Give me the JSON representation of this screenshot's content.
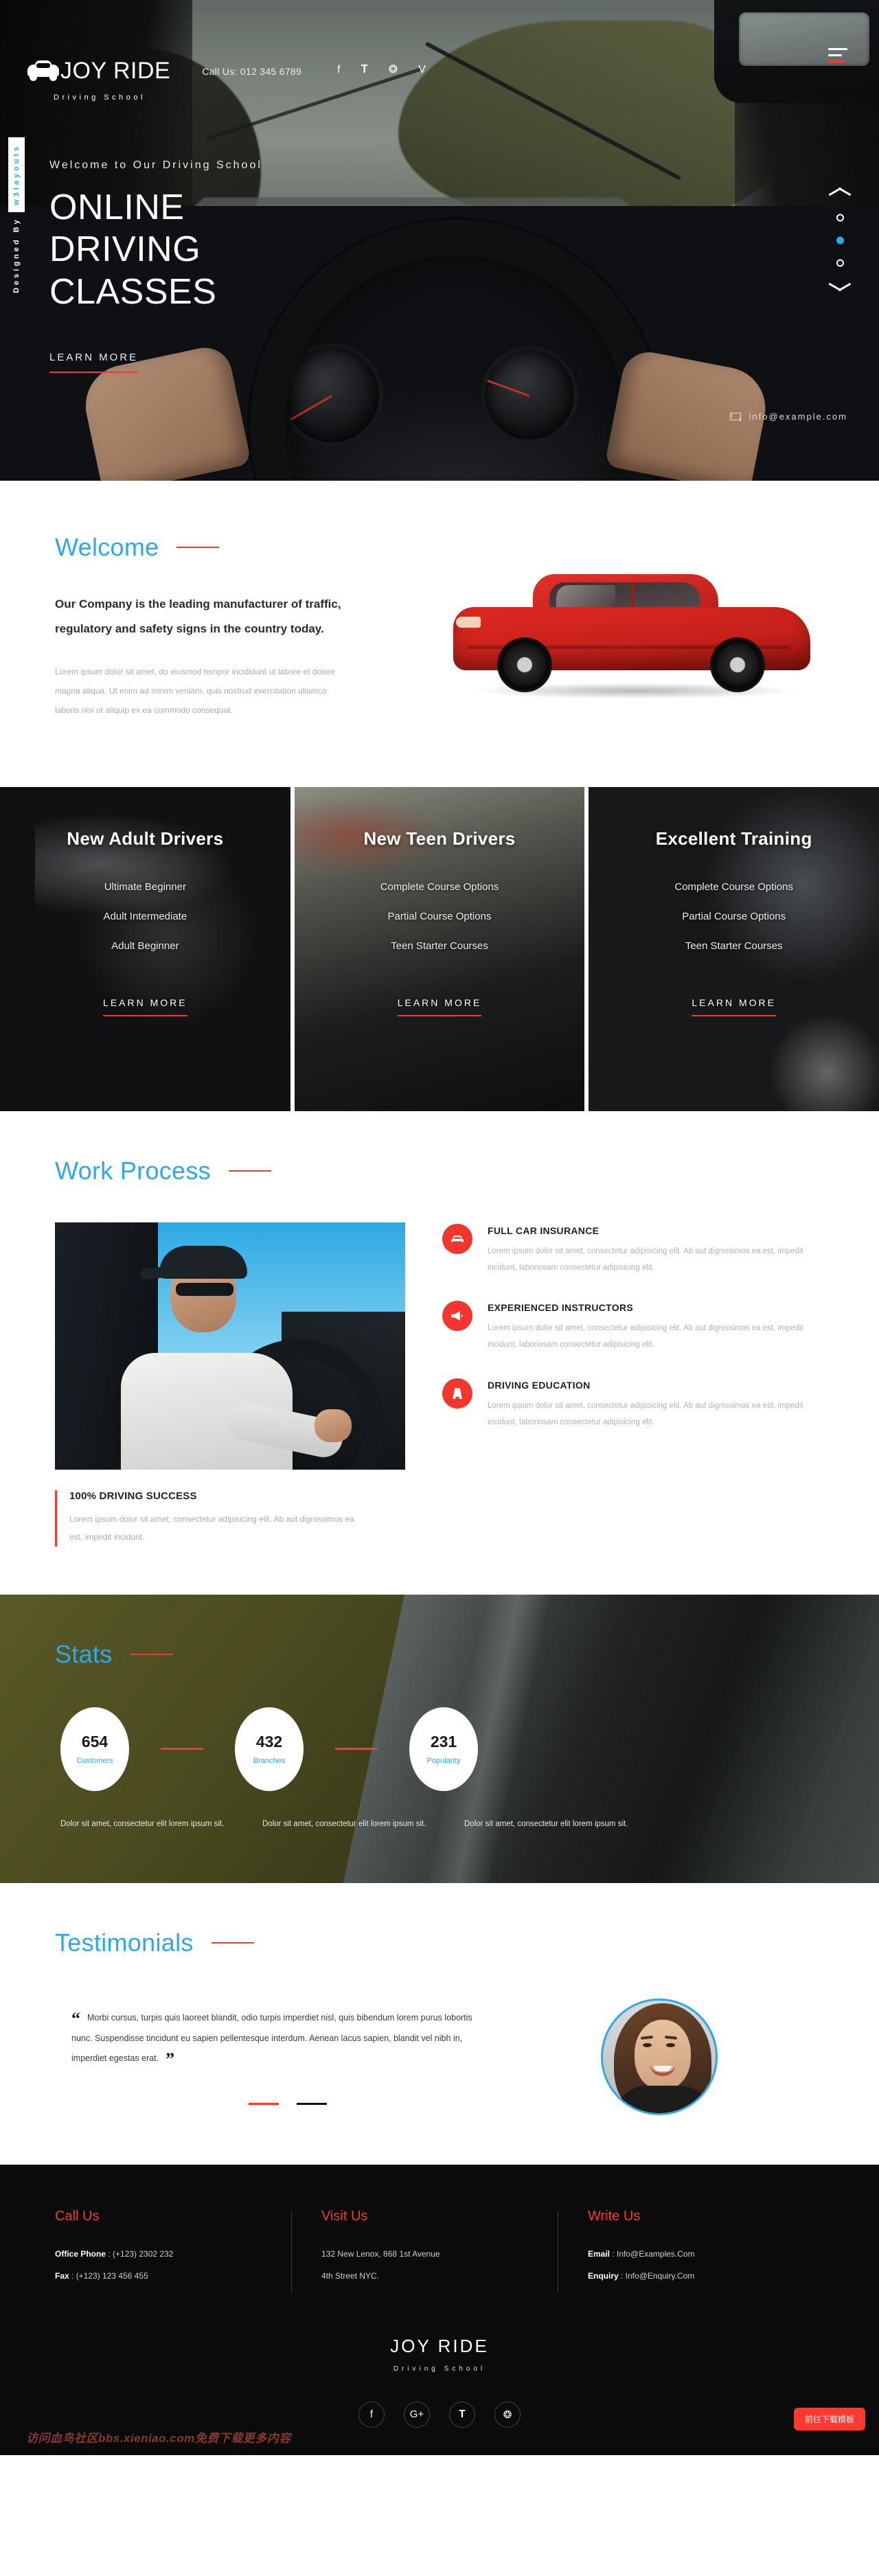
{
  "header": {
    "brand_name": "JOY RIDE",
    "brand_sub": "Driving School",
    "call_us": "Call Us: 012 345 6789",
    "social": [
      "f",
      "𝐓",
      "❂",
      "V"
    ],
    "social_names": [
      "facebook",
      "twitter",
      "dribbble",
      "vimeo"
    ]
  },
  "hero": {
    "designed_by": "Designed By",
    "designed_brand": "w3layouts",
    "kicker": "Welcome to Our Driving School",
    "title": "ONLINE DRIVING CLASSES",
    "cta": "LEARN MORE",
    "email": "info@example.com",
    "slide_count": 3,
    "active_slide": 2
  },
  "welcome": {
    "title": "Welcome",
    "heading": "Our Company is the leading manufacturer of traffic, regulatory and safety signs in the country today.",
    "paragraph": "Lorem ipsum dolor sit amet, do eiusmod tempor incididunt ut labore et dolore magna aliqua. Ut enim ad minim veniam, quis nostrud exercitation ullamco laboris nisi ut aliquip ex ea commodo consequat."
  },
  "courses": [
    {
      "title": "New Adult Drivers",
      "items": [
        "Ultimate Beginner",
        "Adult Intermediate",
        "Adult Beginner"
      ],
      "cta": "LEARN MORE"
    },
    {
      "title": "New Teen Drivers",
      "items": [
        "Complete Course Options",
        "Partial Course Options",
        "Teen Starter Courses"
      ],
      "cta": "LEARN MORE"
    },
    {
      "title": "Excellent Training",
      "items": [
        "Complete Course Options",
        "Partial Course Options",
        "Teen Starter Courses"
      ],
      "cta": "LEARN MORE"
    }
  ],
  "work": {
    "title": "Work Process",
    "success_heading": "100% DRIVING SUCCESS",
    "success_text": "Lorem ipsum dolor sit amet, consectetur adipisicing elit. Ab aut dignissimos ea est, impedit incidunt.",
    "features": [
      {
        "icon": "car-icon",
        "heading": "FULL CAR INSURANCE",
        "text": "Lorem ipsum dolor sit amet, consectetur adipisicing elit. Ab aut dignissimos ea est, impedit incidunt, laboriosam consectetur adipisicing elit."
      },
      {
        "icon": "megaphone-icon",
        "heading": "EXPERIENCED INSTRUCTORS",
        "text": "Lorem ipsum dolor sit amet, consectetur adipisicing elit. Ab aut dignissimos ea est, impedit incidunt, laboriosam consectetur adipisicing elit."
      },
      {
        "icon": "road-icon",
        "heading": "DRIVING EDUCATION",
        "text": "Lorem ipsum dolor sit amet, consectetur adipisicing elit. Ab aut dignissimos ea est, impedit incidunt, laboriosam consectetur adipisicing elit."
      }
    ]
  },
  "stats": {
    "title": "Stats",
    "items": [
      {
        "value": "654",
        "label": "Customers",
        "desc": "Dolor sit amet, consectetur elit lorem ipsum sit."
      },
      {
        "value": "432",
        "label": "Branches",
        "desc": "Dolor sit amet, consectetur elit lorem ipsum sit."
      },
      {
        "value": "231",
        "label": "Popularity",
        "desc": "Dolor sit amet, consectetur elit lorem ipsum sit."
      }
    ]
  },
  "chart_data": {
    "type": "bar",
    "title": "Stats",
    "categories": [
      "Customers",
      "Branches",
      "Popularity"
    ],
    "values": [
      654,
      432,
      231
    ],
    "xlabel": "",
    "ylabel": "",
    "ylim": [
      0,
      700
    ]
  },
  "testimonials": {
    "title": "Testimonials",
    "quote_open": "“",
    "quote_close": "”",
    "quote": "Morbi cursus, turpis quis laoreet blandit, odio turpis imperdiet nisl, quis bibendum lorem purus lobortis nunc. Suspendisse tincidunt eu sapien pellentesque interdum. Aenean lacus sapien, blandit vel nibh in, imperdiet egestas erat.",
    "nav_count": 2,
    "nav_active": 2
  },
  "footer": {
    "columns": [
      {
        "heading": "Call Us",
        "lines": [
          {
            "label": "Office Phone",
            "value": " : (+123) 2302 232"
          },
          {
            "label": "Fax",
            "value": " : (+123) 123 456 455"
          }
        ]
      },
      {
        "heading": "Visit Us",
        "lines": [
          {
            "label": "",
            "value": "132 New Lenox, 868 1st Avenue"
          },
          {
            "label": "",
            "value": "4th Street NYC."
          }
        ]
      },
      {
        "heading": "Write Us",
        "lines": [
          {
            "label": "Email",
            "value": " : Info@Examples.Com"
          },
          {
            "label": "Enquiry",
            "value": " : Info@Enquiry.Com"
          }
        ]
      }
    ],
    "brand_name": "JOY RIDE",
    "brand_sub": "Driving School",
    "social": [
      "f",
      "G+",
      "𝐓",
      "❂"
    ],
    "social_names": [
      "facebook",
      "google-plus",
      "twitter",
      "dribbble"
    ],
    "watermark": "访问血鸟社区bbs.xieniao.com免费下载更多内容",
    "download_button": "前往下载模板"
  },
  "colors": {
    "accent_blue": "#2fa8e8",
    "accent_red": "#ef3d36",
    "dark": "#0b0b0c"
  }
}
